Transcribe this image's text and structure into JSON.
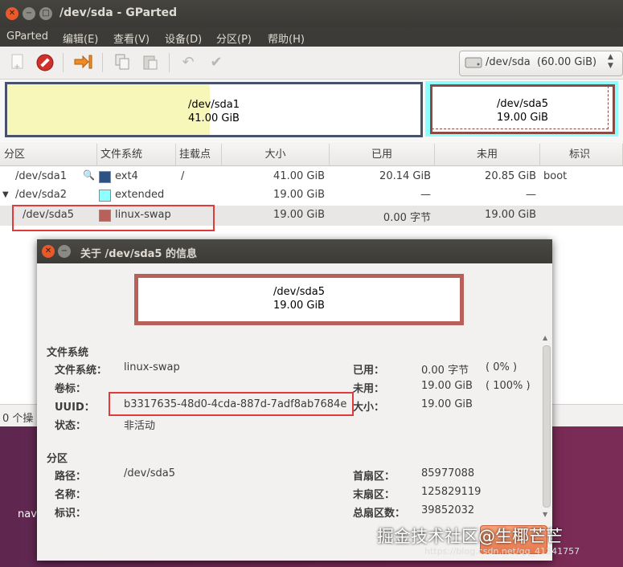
{
  "window": {
    "title": "/dev/sda - GParted"
  },
  "menubar": [
    "GParted",
    "编辑(E)",
    "查看(V)",
    "设备(D)",
    "分区(P)",
    "帮助(H)"
  ],
  "toolbar": {
    "icons": [
      "new-partition-icon",
      "delete-icon",
      "resize-move-icon",
      "copy-icon",
      "paste-icon",
      "undo-icon",
      "apply-icon"
    ],
    "device_selector": "/dev/sda  (60.00 GiB)"
  },
  "graph": {
    "sda1": {
      "name": "/dev/sda1",
      "size": "41.00 GiB",
      "used_fraction": 0.49
    },
    "sda5": {
      "name": "/dev/sda5",
      "size": "19.00 GiB"
    }
  },
  "table": {
    "headers": [
      "分区",
      "文件系统",
      "挂载点",
      "大小",
      "已用",
      "未用",
      "标识"
    ],
    "rows": [
      {
        "partition": "/dev/sda1",
        "fs": "ext4",
        "fs_color": "#2c5286",
        "mount": "/",
        "size": "41.00 GiB",
        "used": "20.14 GiB",
        "unused": "20.85 GiB",
        "flags": "boot"
      },
      {
        "partition": "/dev/sda2",
        "fs": "extended",
        "fs_color": "#8dffff",
        "mount": "",
        "size": "19.00 GiB",
        "used": "—",
        "unused": "—",
        "flags": ""
      },
      {
        "partition": "/dev/sda5",
        "fs": "linux-swap",
        "fs_color": "#b8615a",
        "mount": "",
        "size": "19.00 GiB",
        "used": "0.00 字节",
        "unused": "19.00 GiB",
        "flags": ""
      }
    ]
  },
  "statusbar": {
    "text": "0 个操"
  },
  "desktop": {
    "label": "nav"
  },
  "dialog": {
    "title": "关于 /dev/sda5 的信息",
    "graph_name": "/dev/sda5",
    "graph_size": "19.00 GiB",
    "fs_section": "文件系统",
    "fs_label": "文件系统：",
    "fs_value": "linux-swap",
    "vol_label": "卷标：",
    "vol_value": "",
    "uuid_label": "UUID：",
    "uuid_value": "b3317635-48d0-4cda-887d-7adf8ab7684e",
    "state_label": "状态：",
    "state_value": "非活动",
    "used_label": "已用：",
    "used_value": "0.00 字节",
    "used_pct": "( 0% )",
    "unused_label": "未用：",
    "unused_value": "19.00 GiB",
    "unused_pct": "( 100% )",
    "size_label": "大小：",
    "size_value": "19.00 GiB",
    "part_section": "分区",
    "path_label": "路径：",
    "path_value": "/dev/sda5",
    "name_label": "名称：",
    "flags_label": "标识：",
    "first_label": "首扇区：",
    "first_value": "85977088",
    "last_label": "末扇区：",
    "last_value": "125829119",
    "total_label": "总扇区数：",
    "total_value": "39852032"
  },
  "watermark": {
    "text": "掘金技术社区@生椰芒芒",
    "url": "https://blog.csdn.net/qq_41341757"
  }
}
